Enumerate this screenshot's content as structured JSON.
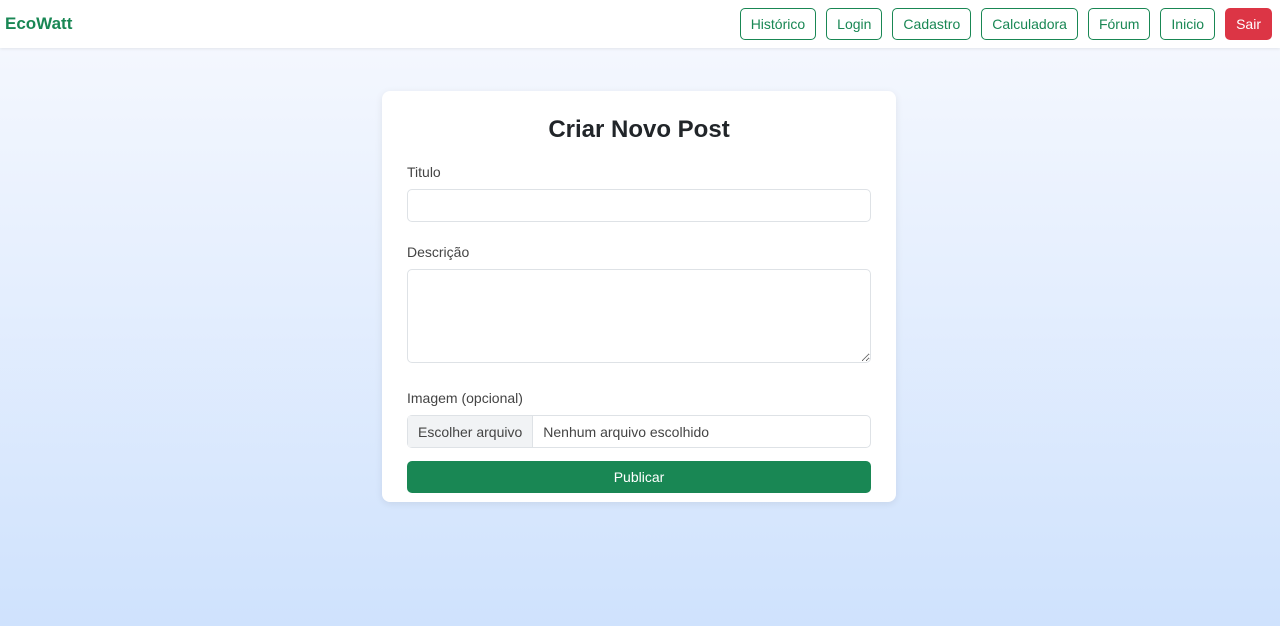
{
  "brand": "EcoWatt",
  "nav": [
    "Histórico",
    "Login",
    "Cadastro",
    "Calculadora",
    "Fórum",
    "Inicio",
    "Sair"
  ],
  "form": {
    "title": "Criar Novo Post",
    "titulo_label": "Titulo",
    "descricao_label": "Descrição",
    "imagem_label": "Imagem (opcional)",
    "file_button": "Escolher arquivo",
    "file_status": "Nenhum arquivo escolhido",
    "submit": "Publicar"
  },
  "colors": {
    "brand": "#198754",
    "danger": "#dc3545"
  }
}
